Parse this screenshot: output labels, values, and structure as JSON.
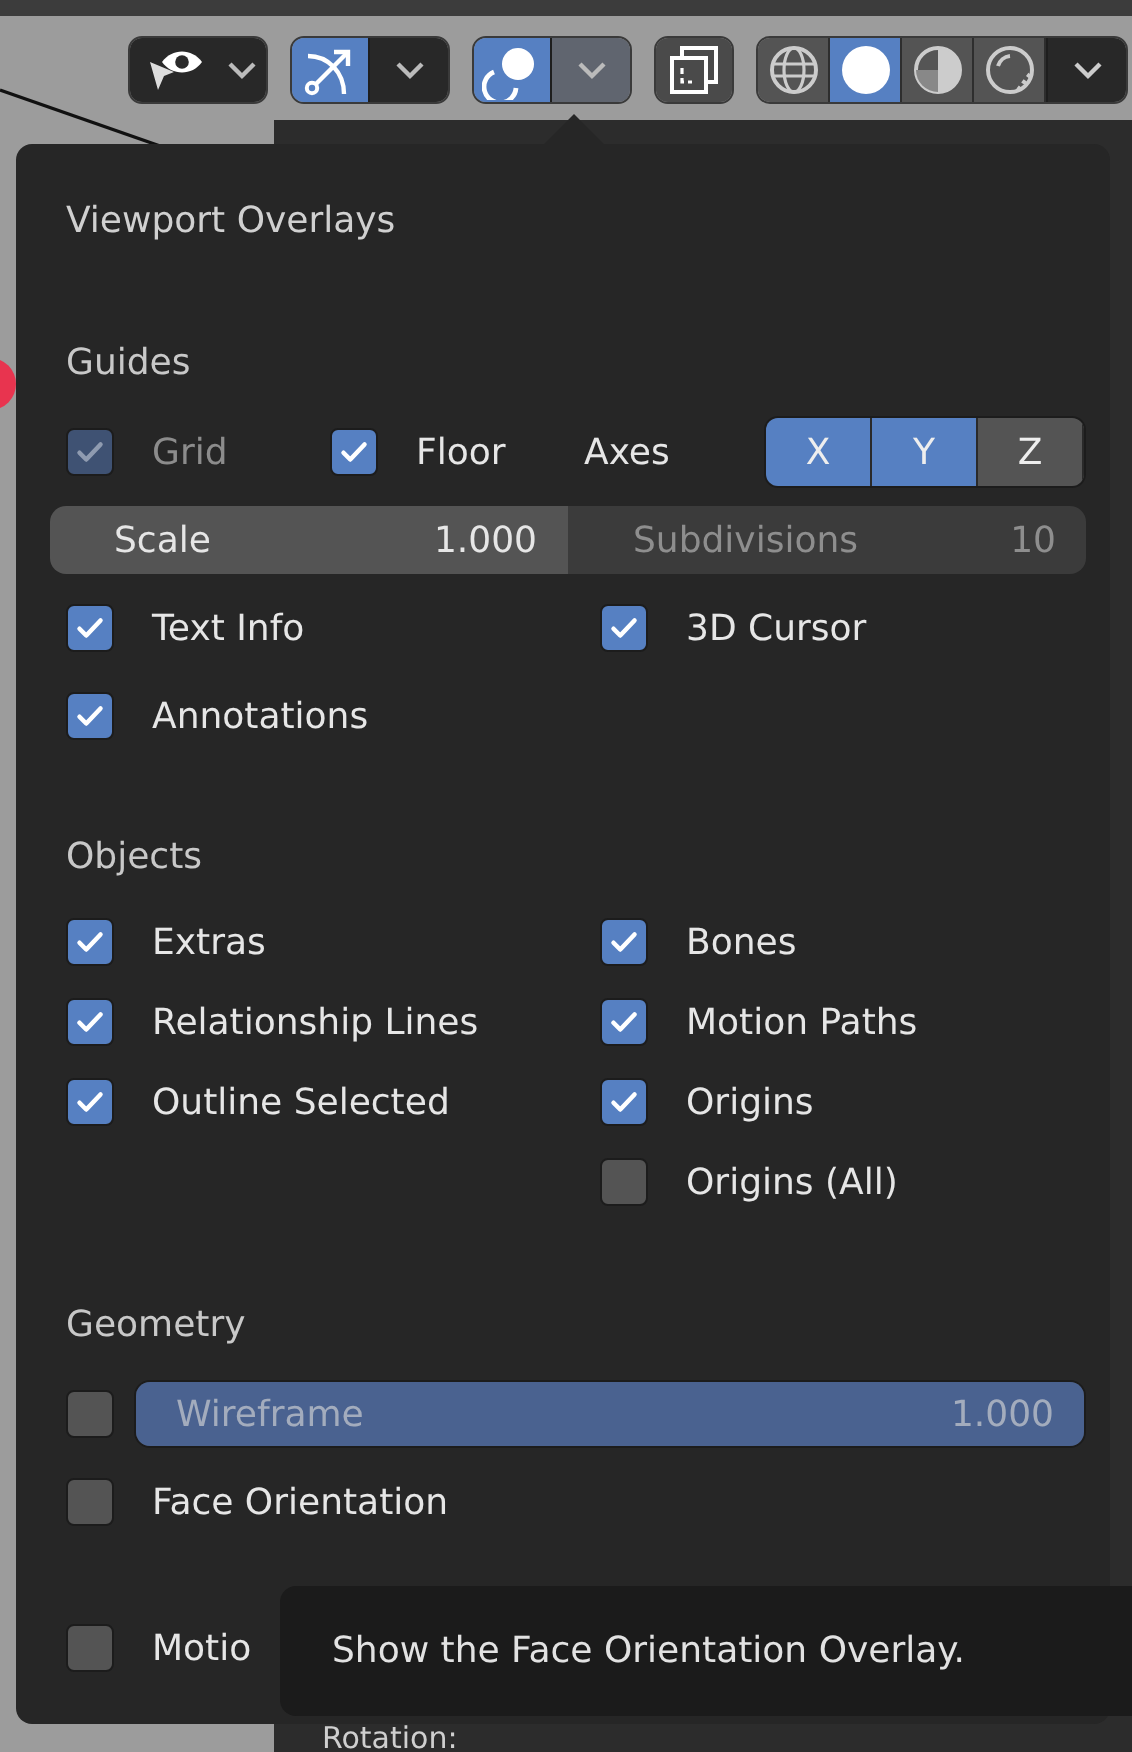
{
  "header": {
    "toggles": [
      {
        "kind": "visibility",
        "selected": false
      },
      {
        "kind": "gizmo",
        "selected": true,
        "open": false
      },
      {
        "kind": "overlay",
        "selected": true,
        "open": true
      },
      {
        "kind": "xray",
        "selected": false
      }
    ],
    "shading": [
      {
        "kind": "wireframe",
        "selected": false
      },
      {
        "kind": "solid",
        "selected": true
      },
      {
        "kind": "material",
        "selected": false
      },
      {
        "kind": "rendered",
        "selected": false
      }
    ],
    "shading_dropdown": {
      "open": false
    }
  },
  "sidebar": {
    "label": "Rotation:"
  },
  "popup": {
    "title": "Viewport Overlays",
    "sections": [
      {
        "heading": "Guides",
        "rows": [
          {
            "kind": "guides",
            "grid": {
              "label": "Grid",
              "checked": true,
              "disabled": true
            },
            "floor": {
              "label": "Floor",
              "checked": true,
              "disabled": false
            },
            "axes_label": "Axes",
            "axes": [
              {
                "label": "X",
                "selected": true
              },
              {
                "label": "Y",
                "selected": true
              },
              {
                "label": "Z",
                "selected": false
              }
            ]
          },
          {
            "kind": "fields",
            "fields": [
              {
                "label": "Scale",
                "value": "1.000",
                "disabled": false
              },
              {
                "label": "Subdivisions",
                "value": "10",
                "disabled": true
              }
            ]
          },
          {
            "kind": "pair",
            "left": {
              "label": "Text Info",
              "checked": true,
              "disabled": false
            },
            "right": {
              "label": "3D Cursor",
              "checked": true,
              "disabled": false
            }
          },
          {
            "kind": "pair",
            "left": {
              "label": "Annotations",
              "checked": true,
              "disabled": false
            }
          }
        ]
      },
      {
        "heading": "Objects",
        "rows": [
          {
            "kind": "pair",
            "left": {
              "label": "Extras",
              "checked": true,
              "disabled": false
            },
            "right": {
              "label": "Bones",
              "checked": true,
              "disabled": false
            }
          },
          {
            "kind": "pair",
            "left": {
              "label": "Relationship Lines",
              "checked": true,
              "disabled": false
            },
            "right": {
              "label": "Motion Paths",
              "checked": true,
              "disabled": false
            }
          },
          {
            "kind": "pair",
            "left": {
              "label": "Outline Selected",
              "checked": true,
              "disabled": false
            },
            "right": {
              "label": "Origins",
              "checked": true,
              "disabled": false
            }
          },
          {
            "kind": "pair",
            "right": {
              "label": "Origins (All)",
              "checked": false,
              "disabled": false
            }
          }
        ]
      },
      {
        "heading": "Geometry",
        "rows": [
          {
            "kind": "slider",
            "check": {
              "checked": false,
              "disabled": false
            },
            "label": "Wireframe",
            "value": "1.000",
            "level": 1
          },
          {
            "kind": "pair",
            "left": {
              "label": "Face Orientation",
              "checked": false,
              "disabled": false
            }
          },
          {
            "kind": "pair",
            "left": {
              "label": "Motio",
              "checked": false,
              "disabled": false
            }
          }
        ]
      }
    ]
  },
  "tooltip": "Show the Face Orientation Overlay."
}
